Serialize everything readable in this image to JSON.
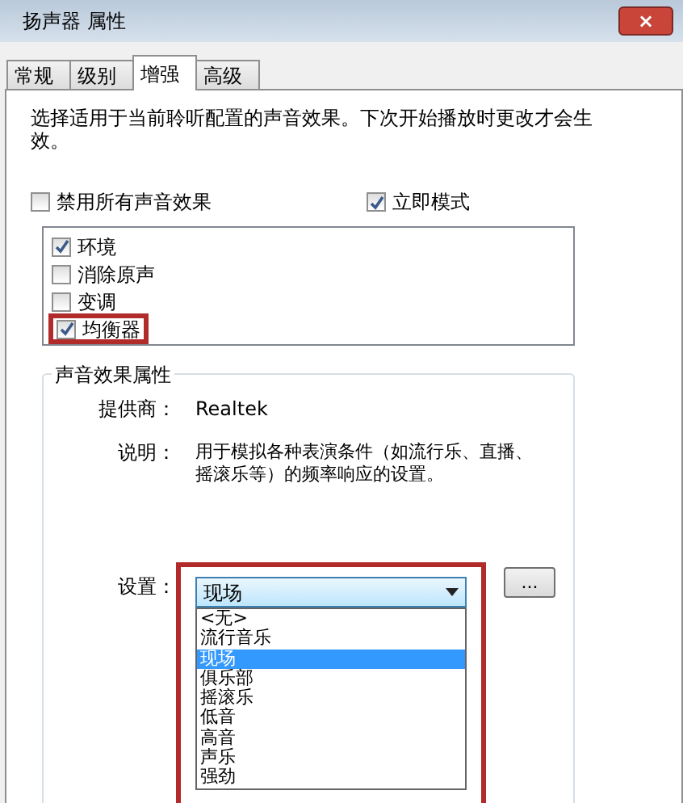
{
  "window": {
    "title": "扬声器 属性",
    "close": "×"
  },
  "tabs": [
    {
      "label": "常规",
      "selected": false
    },
    {
      "label": "级别",
      "selected": false
    },
    {
      "label": "增强",
      "selected": true
    },
    {
      "label": "高级",
      "selected": false
    }
  ],
  "description": "选择适用于当前聆听配置的声音效果。下次开始播放时更改才会生效。",
  "options": [
    {
      "label": "禁用所有声音效果",
      "checked": false
    },
    {
      "label": "立即模式",
      "checked": true
    }
  ],
  "effects": [
    {
      "label": "环境",
      "checked": true,
      "highlighted": false
    },
    {
      "label": "消除原声",
      "checked": false,
      "highlighted": false
    },
    {
      "label": "变调",
      "checked": false,
      "highlighted": false
    },
    {
      "label": "均衡器",
      "checked": true,
      "highlighted": true
    }
  ],
  "properties": {
    "title": "声音效果属性",
    "provider_label": "提供商：",
    "provider": "Realtek",
    "info_label": "说明：",
    "info": "用于模拟各种表演条件（如流行乐、直播、摇滚乐等）的频率响应的设置。",
    "setting_label": "设置：",
    "setting_value": "现场",
    "more_button": "...",
    "dropdown": [
      {
        "label": "<无>",
        "selected": false
      },
      {
        "label": "流行音乐",
        "selected": false
      },
      {
        "label": "现场",
        "selected": true
      },
      {
        "label": "俱乐部",
        "selected": false
      },
      {
        "label": "摇滚乐",
        "selected": false
      },
      {
        "label": "低音",
        "selected": false
      },
      {
        "label": "高音",
        "selected": false
      },
      {
        "label": "声乐",
        "selected": false
      },
      {
        "label": "强劲",
        "selected": false
      }
    ]
  }
}
